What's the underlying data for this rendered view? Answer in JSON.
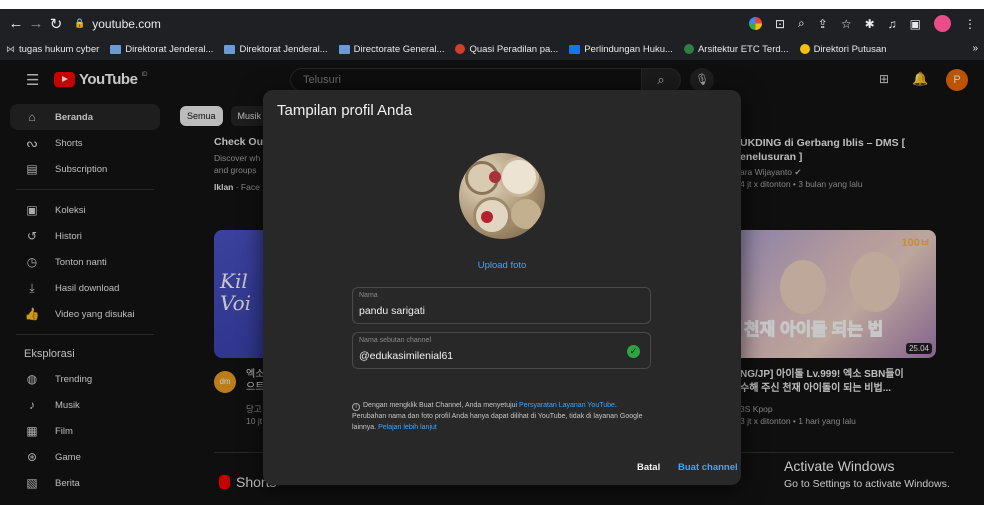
{
  "browser": {
    "url": "youtube.com",
    "bookmarks": [
      {
        "label": "tugas hukum cyber",
        "icon": "bookmark-icon"
      },
      {
        "label": "Direktorat Jenderal...",
        "icon": "folder-icon"
      },
      {
        "label": "Direktorat Jenderal...",
        "icon": "folder-icon"
      },
      {
        "label": "Directorate General...",
        "icon": "folder-icon"
      },
      {
        "label": "Quasi Peradilan pa...",
        "icon": "globe-icon"
      },
      {
        "label": "Perlindungan Huku...",
        "icon": "doc-icon"
      },
      {
        "label": "Arsitektur ETC Terd...",
        "icon": "globe-icon"
      },
      {
        "label": "Direktori Putusan",
        "icon": "globe-icon"
      }
    ],
    "more": "»"
  },
  "youtube": {
    "logo_text": "YouTube",
    "logo_sup": "ID",
    "search_placeholder": "Telusuri",
    "avatar_letter": "P",
    "sidebar": {
      "main": [
        {
          "label": "Beranda",
          "icon": "home-icon",
          "glyph": "⌂"
        },
        {
          "label": "Shorts",
          "icon": "shorts-icon",
          "glyph": "ᔓ"
        },
        {
          "label": "Subscription",
          "icon": "subscriptions-icon",
          "glyph": "▤"
        }
      ],
      "library": [
        {
          "label": "Koleksi",
          "icon": "library-icon",
          "glyph": "▣"
        },
        {
          "label": "Histori",
          "icon": "history-icon",
          "glyph": "↺"
        },
        {
          "label": "Tonton nanti",
          "icon": "watch-later-icon",
          "glyph": "◷"
        },
        {
          "label": "Hasil download",
          "icon": "download-icon",
          "glyph": "⤓"
        },
        {
          "label": "Video yang disukai",
          "icon": "like-icon",
          "glyph": "👍"
        }
      ],
      "explore_heading": "Eksplorasi",
      "explore": [
        {
          "label": "Trending",
          "icon": "trending-icon",
          "glyph": "◍"
        },
        {
          "label": "Musik",
          "icon": "music-icon",
          "glyph": "♪"
        },
        {
          "label": "Film",
          "icon": "film-icon",
          "glyph": "▦"
        },
        {
          "label": "Game",
          "icon": "game-icon",
          "glyph": "⊛"
        },
        {
          "label": "Berita",
          "icon": "news-icon",
          "glyph": "▧"
        }
      ]
    },
    "chips": [
      "Semua",
      "Musik"
    ],
    "ad": {
      "title": "Check Out",
      "desc": "Discover wh and groups",
      "meta_bold": "Iklan",
      "meta_rest": " · Face"
    },
    "video1": {
      "thumb_text": "Kil Voi",
      "avatar": "dm",
      "title_line1": "엑소",
      "title_line2": "으트",
      "meta_line1": "당고",
      "meta_line2": "10 jt"
    },
    "right_top": {
      "title_line1": "UKDING di Gerbang Iblis – DMS [",
      "title_line2": "enelusuran ]",
      "meta_line1": "ara Wijayanto ✔",
      "meta_line2": "4 jt x ditonton • 3 bulan yang lalu"
    },
    "video2": {
      "thumb_label": "천재 아이돌 되는 법",
      "thumb_tag": "100ㅂ",
      "duration": "25.04",
      "title_line1": "NG/JP] 아이돌 Lv.999! 엑소 SBN들이",
      "title_line2": "수해 주신 천재 아이돌이 되는 비법...",
      "meta_line1": "3S Kpop",
      "meta_line2": "3 jt x ditonton • 1 hari yang lalu"
    },
    "shorts_label": "Shorts"
  },
  "modal": {
    "title": "Tampilan profil Anda",
    "upload_label": "Upload foto",
    "name_label": "Nama",
    "name_value": "pandu sarigati",
    "handle_label": "Nama sebutan channel",
    "handle_value": "@edukasimilenial61",
    "info_text_1": "Dengan mengklik Buat Channel, Anda menyetujui ",
    "info_link_1": "Persyaratan Layanan YouTube",
    "info_text_2": ". Perubahan nama dan foto profil Anda hanya dapat dilihat di YouTube, tidak di layanan Google lainnya. ",
    "info_link_2": "Pelajari lebih lanjut",
    "cancel_label": "Batal",
    "create_label": "Buat channel"
  },
  "windows_notice": {
    "title": "Activate Windows",
    "subtitle": "Go to Settings to activate Windows."
  },
  "colors": {
    "accent_blue": "#3ea6ff",
    "youtube_red": "#ff0000",
    "modal_bg": "#282828",
    "page_bg": "#0f0f0f",
    "check_green": "#2ba640"
  }
}
